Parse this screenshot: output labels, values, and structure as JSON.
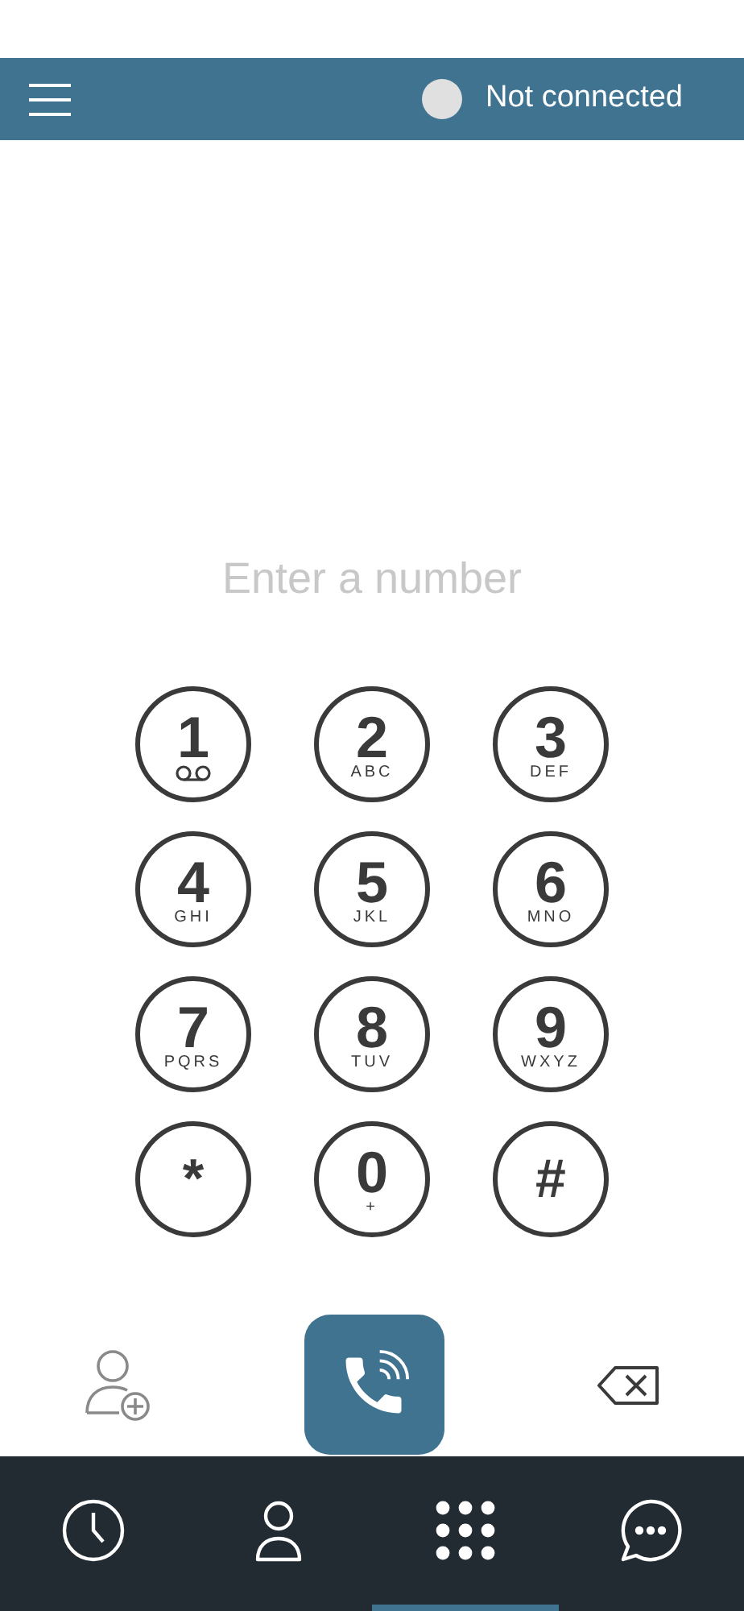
{
  "header": {
    "status": "Not connected",
    "connected": false
  },
  "number_field": {
    "placeholder": "Enter a number"
  },
  "keys": [
    {
      "digit": "1",
      "kind": "voicemail"
    },
    {
      "digit": "2",
      "letters": "ABC",
      "kind": "letters"
    },
    {
      "digit": "3",
      "letters": "DEF",
      "kind": "letters"
    },
    {
      "digit": "4",
      "letters": "GHI",
      "kind": "letters"
    },
    {
      "digit": "5",
      "letters": "JKL",
      "kind": "letters"
    },
    {
      "digit": "6",
      "letters": "MNO",
      "kind": "letters"
    },
    {
      "digit": "7",
      "letters": "PQRS",
      "kind": "letters"
    },
    {
      "digit": "8",
      "letters": "TUV",
      "kind": "letters"
    },
    {
      "digit": "9",
      "letters": "WXYZ",
      "kind": "letters"
    },
    {
      "digit": "*",
      "kind": "symbol"
    },
    {
      "digit": "0",
      "letters": "+",
      "kind": "letters"
    },
    {
      "digit": "#",
      "kind": "symbol"
    }
  ],
  "nav": [
    {
      "kind": "history",
      "selected": false
    },
    {
      "kind": "contacts",
      "selected": false
    },
    {
      "kind": "keypad",
      "selected": true
    },
    {
      "kind": "chat",
      "selected": false
    }
  ]
}
